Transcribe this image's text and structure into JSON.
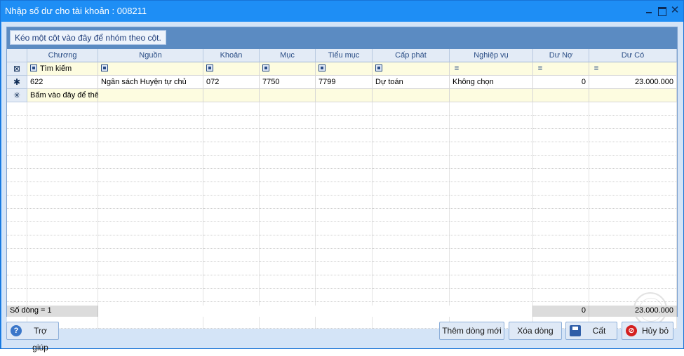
{
  "window": {
    "title": "Nhập số dư cho tài khoản : 008211",
    "minimize_icon": "minimize-icon",
    "maximize_icon": "maximize-icon",
    "close_glyph": "✕"
  },
  "group_panel": {
    "hint": "Kéo một cột vào đây để nhóm theo cột."
  },
  "grid": {
    "columns": [
      "Chương",
      "Nguồn",
      "Khoản",
      "Mục",
      "Tiểu mục",
      "Cấp phát",
      "Nghiệp vụ",
      "Dư Nợ",
      "Dư Có"
    ],
    "filter_row": {
      "indicator_glyph": "⊠",
      "search_label": "Tìm kiếm",
      "eq_glyph": "="
    },
    "rows": [
      {
        "indicator_glyph": "✱",
        "cells": [
          "622",
          "Ngân sách Huyện tự chủ",
          "072",
          "7750",
          "7799",
          "Dự toán",
          "Không chọn",
          "0",
          "23.000.000"
        ]
      }
    ],
    "new_row": {
      "indicator_glyph": "✳",
      "label": "Bấm vào đây để thêm mới"
    },
    "footer": {
      "row_count": "Số dòng = 1",
      "sum_du_no": "0",
      "sum_du_co": "23.000.000"
    }
  },
  "buttons": {
    "help": {
      "label": "Trợ giúp",
      "icon": "help-icon",
      "glyph": "?"
    },
    "add_row": {
      "label": "Thêm dòng mới"
    },
    "delete_row": {
      "label": "Xóa dòng"
    },
    "save": {
      "label": "Cất",
      "icon": "save-icon"
    },
    "cancel": {
      "label": "Hủy bỏ",
      "icon": "cancel-icon",
      "glyph": "⊘"
    }
  },
  "colors": {
    "titlebar": "#1e8ef5",
    "group_panel": "#5b8bc2",
    "filter_row_bg": "#fdfce0",
    "header_text": "#2a4d85"
  }
}
